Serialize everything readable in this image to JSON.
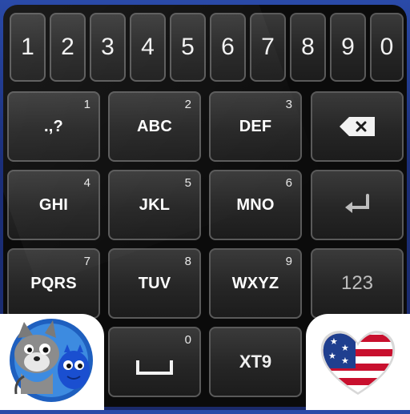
{
  "number_row": [
    "1",
    "2",
    "3",
    "4",
    "5",
    "6",
    "7",
    "8",
    "9",
    "0"
  ],
  "keys": {
    "k1": {
      "label": ".,?",
      "num": "1"
    },
    "k2": {
      "label": "ABC",
      "num": "2"
    },
    "k3": {
      "label": "DEF",
      "num": "3"
    },
    "k4": {
      "label": "GHI",
      "num": "4"
    },
    "k5": {
      "label": "JKL",
      "num": "5"
    },
    "k6": {
      "label": "MNO",
      "num": "6"
    },
    "k7": {
      "label": "PQRS",
      "num": "7"
    },
    "k8": {
      "label": "TUV",
      "num": "8"
    },
    "k9": {
      "label": "WXYZ",
      "num": "9"
    },
    "space": {
      "num": "0"
    }
  },
  "mode_label": "123",
  "xt9_label": "XT9",
  "icons": {
    "backspace": "backspace-icon",
    "enter": "enter-icon",
    "space": "space-icon",
    "cat_logo": "cat-mascot-logo",
    "flag": "us-flag-heart-icon"
  },
  "colors": {
    "background": "#1b2f7a",
    "key_face": "#262626",
    "key_border": "#5a5a5a",
    "panel": "#0b0b0b"
  }
}
